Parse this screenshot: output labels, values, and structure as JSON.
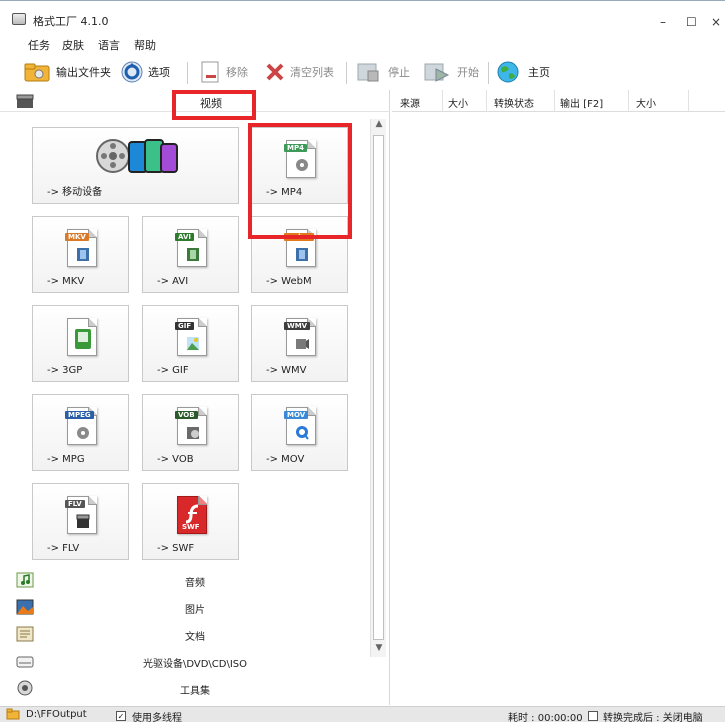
{
  "window": {
    "title": "格式工厂 4.1.0",
    "minimize": "–",
    "maximize": "☐",
    "close": "×"
  },
  "menu": [
    "任务",
    "皮肤",
    "语言",
    "帮助"
  ],
  "toolbar": {
    "output_folder": "输出文件夹",
    "options": "选项",
    "remove": "移除",
    "clear_list": "清空列表",
    "stop": "停止",
    "start": "开始",
    "home": "主页"
  },
  "category_header": {
    "label": "视频"
  },
  "tiles": [
    {
      "label": "-> 移动设备"
    },
    {
      "label": "-> MP4",
      "tag": "MP4",
      "tag_color": "#3d9a58",
      "glyph_color": "#777777"
    },
    {
      "label": "-> MKV",
      "tag": "MKV",
      "tag_color": "#d9792a",
      "glyph_color": "#3d6fa8"
    },
    {
      "label": "-> AVI",
      "tag": "AVI",
      "tag_color": "#2e7a2e",
      "glyph_color": "#3c7a3c"
    },
    {
      "label": "-> WebM",
      "tag": "webm",
      "tag_color": "#e07a1c",
      "glyph_color": "#3d6fa8"
    },
    {
      "label": "-> 3GP",
      "tag": "",
      "tag_color": "#3a9a3a",
      "glyph_color": "#3a9a3a"
    },
    {
      "label": "-> GIF",
      "tag": "GIF",
      "tag_color": "#333333",
      "glyph_color": "#4aa0d8"
    },
    {
      "label": "-> WMV",
      "tag": "WMV",
      "tag_color": "#3d3d3d",
      "glyph_color": "#7a7a7a"
    },
    {
      "label": "-> MPG",
      "tag": "MPEG",
      "tag_color": "#2a5fa8",
      "glyph_color": "#8a8a8a"
    },
    {
      "label": "-> VOB",
      "tag": "VOB",
      "tag_color": "#2a5a2a",
      "glyph_color": "#6a6a6a"
    },
    {
      "label": "-> MOV",
      "tag": "MOV",
      "tag_color": "#3a8ad8",
      "glyph_color": "#2a7ad8"
    },
    {
      "label": "-> FLV",
      "tag": "FLV",
      "tag_color": "#555555",
      "glyph_color": "#333333"
    },
    {
      "label": "-> SWF",
      "tag": "SWF",
      "tag_color": "#d8282a",
      "glyph_color": "#d8282a"
    }
  ],
  "categories": [
    "音频",
    "图片",
    "文档",
    "光驱设备\\DVD\\CD\\ISO",
    "工具集"
  ],
  "columns": [
    "来源",
    "大小",
    "转换状态",
    "输出 [F2]",
    "大小"
  ],
  "status": {
    "output_path": "D:\\FFOutput",
    "multithread": "使用多线程",
    "elapsed": "耗时 : 00:00:00",
    "after_convert": "转换完成后 : 关闭电脑"
  }
}
